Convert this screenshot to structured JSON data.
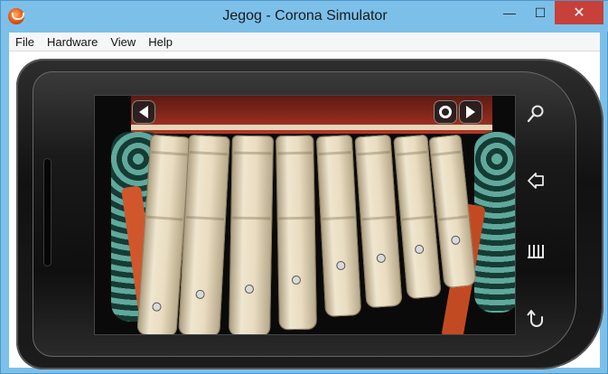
{
  "window": {
    "title": "Jegog - Corona Simulator",
    "controls": {
      "minimize": "—",
      "maximize": "☐",
      "close": "✕"
    }
  },
  "menu": [
    "File",
    "Hardware",
    "View",
    "Help"
  ],
  "app_screen": {
    "buttons": [
      {
        "name": "previous",
        "icon": "triangle-left-icon"
      },
      {
        "name": "record",
        "icon": "circle-icon"
      },
      {
        "name": "next",
        "icon": "triangle-right-icon"
      }
    ]
  },
  "hardware_buttons": [
    {
      "name": "search",
      "icon": "search-icon"
    },
    {
      "name": "home",
      "icon": "home-icon"
    },
    {
      "name": "menu",
      "icon": "menu-icon"
    },
    {
      "name": "back",
      "icon": "back-icon"
    }
  ]
}
